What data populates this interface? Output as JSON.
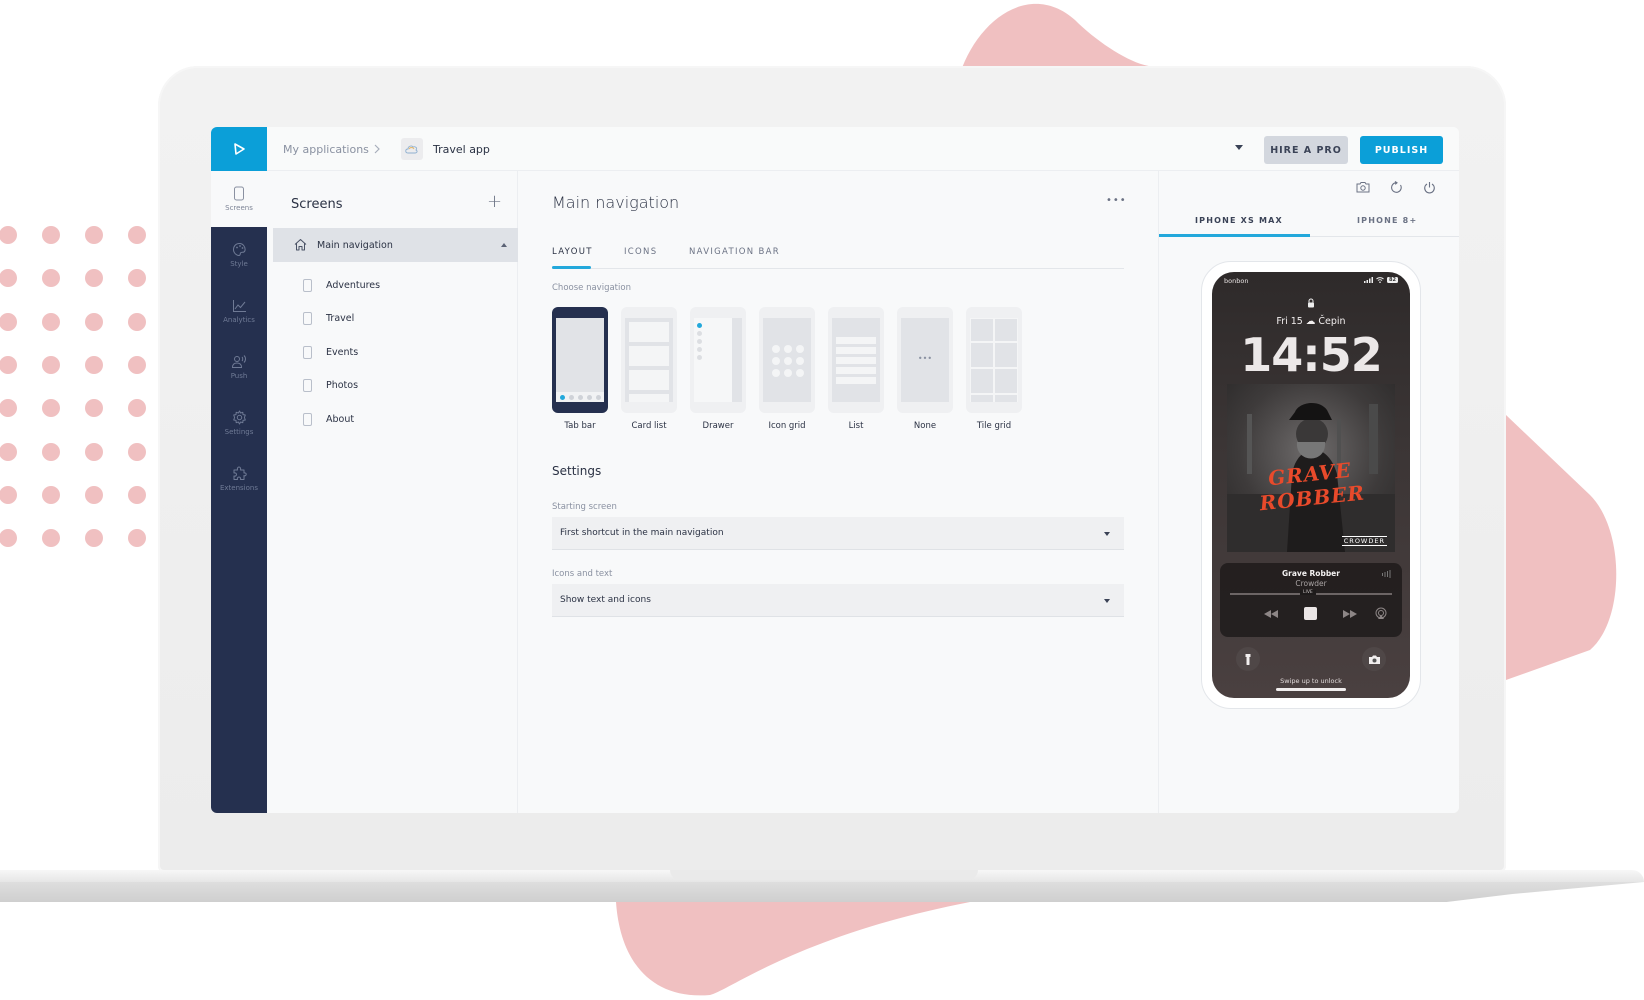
{
  "colors": {
    "accent": "#0b9fd8",
    "rail": "#25304f",
    "decor_pink": "#f0c0c1"
  },
  "header": {
    "logo_icon": "play-triangle-icon",
    "breadcrumb": {
      "root": "My applications",
      "separator": ">",
      "app_icon": "cloud-icon",
      "app": "Travel app"
    },
    "dropdown_icon": "caret-down-icon",
    "hire_label": "HIRE A PRO",
    "publish_label": "PUBLISH"
  },
  "rail": {
    "items": [
      {
        "label": "Screens",
        "icon": "phone-icon",
        "active": true
      },
      {
        "label": "Style",
        "icon": "palette-icon"
      },
      {
        "label": "Analytics",
        "icon": "chart-icon"
      },
      {
        "label": "Push",
        "icon": "broadcast-icon"
      },
      {
        "label": "Settings",
        "icon": "gear-icon"
      },
      {
        "label": "Extensions",
        "icon": "puzzle-icon"
      }
    ]
  },
  "screens": {
    "title": "Screens",
    "add_icon": "+",
    "main": {
      "label": "Main navigation",
      "icon": "home-icon"
    },
    "items": [
      {
        "label": "Adventures"
      },
      {
        "label": "Travel"
      },
      {
        "label": "Events"
      },
      {
        "label": "Photos"
      },
      {
        "label": "About"
      }
    ]
  },
  "main": {
    "title": "Main navigation",
    "more": "•••",
    "tabs": [
      {
        "label": "LAYOUT",
        "active": true
      },
      {
        "label": "ICONS"
      },
      {
        "label": "NAVIGATION BAR"
      }
    ],
    "choose_label": "Choose navigation",
    "nav_options": [
      {
        "label": "Tab bar",
        "selected": true
      },
      {
        "label": "Card list"
      },
      {
        "label": "Drawer"
      },
      {
        "label": "Icon grid"
      },
      {
        "label": "List"
      },
      {
        "label": "None"
      },
      {
        "label": "Tile grid"
      }
    ],
    "settings_title": "Settings",
    "fields": [
      {
        "label": "Starting screen",
        "value": "First shortcut in the main navigation"
      },
      {
        "label": "Icons and text",
        "value": "Show text and icons"
      }
    ]
  },
  "preview": {
    "icons": [
      "camera-icon",
      "refresh-icon",
      "power-icon"
    ],
    "devices": [
      {
        "label": "IPHONE XS MAX",
        "active": true
      },
      {
        "label": "IPHONE 8+"
      }
    ],
    "phone": {
      "carrier": "bonbon",
      "battery": "82",
      "date": "Fri 15 ☁ Čepin",
      "time": "14:52",
      "album_title": "GRAVE ROBBER",
      "album_artist": "CROWDER",
      "track": "Grave Robber",
      "artist": "Crowder",
      "live_label": "LIVE",
      "swipe_text": "Swipe up to unlock"
    }
  }
}
